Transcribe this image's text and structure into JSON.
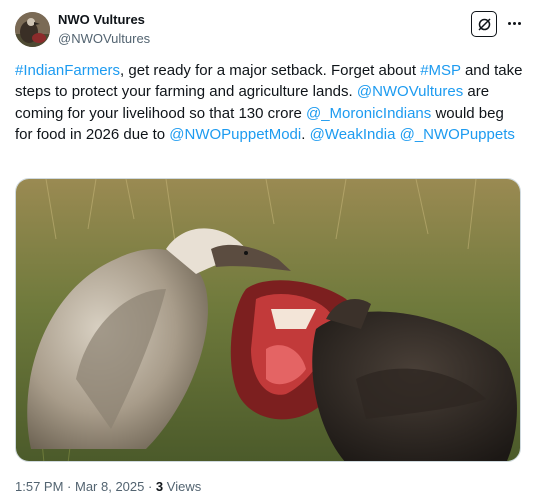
{
  "author": {
    "display_name": "NWO Vultures",
    "handle": "@NWOVultures"
  },
  "icons": {
    "avatar": "vulture-avatar",
    "grok": "grok-icon",
    "more": "more-options-icon"
  },
  "tweet": {
    "segments": [
      {
        "text": "#IndianFarmers",
        "link": true
      },
      {
        "text": ", get ready for a major setback. Forget about ",
        "link": false
      },
      {
        "text": "#MSP",
        "link": true
      },
      {
        "text": " and take steps to protect your farming and agriculture lands. ",
        "link": false
      },
      {
        "text": "@NWOVultures",
        "link": true
      },
      {
        "text": " are coming for your livelihood so that 130 crore ",
        "link": false
      },
      {
        "text": "@_MoronicIndians",
        "link": true
      },
      {
        "text": " would beg for food in 2026 due to ",
        "link": false
      },
      {
        "text": "@NWOPuppetModi",
        "link": true
      },
      {
        "text": ". ",
        "link": false
      },
      {
        "text": "@WeakIndia",
        "link": true
      },
      {
        "text": " ",
        "link": false
      },
      {
        "text": "@_NWOPuppets",
        "link": true
      }
    ]
  },
  "meta": {
    "time": "1:57 PM",
    "separator": " · ",
    "date": "Mar 8, 2025",
    "views_count": "3",
    "views_label": "Views"
  },
  "colors": {
    "link": "#1d9bf0",
    "text": "#0f1419",
    "muted": "#536471"
  }
}
